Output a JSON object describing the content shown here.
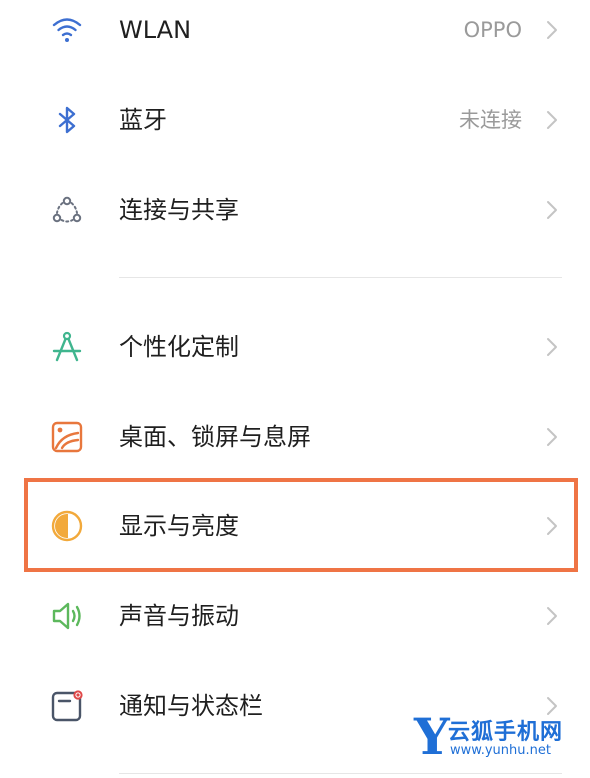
{
  "settings": {
    "items": [
      {
        "label": "WLAN",
        "value": "OPPO"
      },
      {
        "label": "蓝牙",
        "value": "未连接"
      },
      {
        "label": "连接与共享",
        "value": ""
      },
      {
        "label": "个性化定制",
        "value": ""
      },
      {
        "label": "桌面、锁屏与息屏",
        "value": ""
      },
      {
        "label": "显示与亮度",
        "value": ""
      },
      {
        "label": "声音与振动",
        "value": ""
      },
      {
        "label": "通知与状态栏",
        "value": ""
      }
    ]
  },
  "colors": {
    "wifi": "#3d6fd1",
    "bluetooth": "#3d6fd1",
    "connection": "#6b7280",
    "personalize": "#3fb58e",
    "desktop": "#e8773d",
    "display": "#f2a93b",
    "sound": "#5cb85c",
    "notification": "#4a5568",
    "highlight": "#ef7445",
    "watermark": "#1f6fd6"
  },
  "watermark": {
    "logo_letter": "Y",
    "name": "云狐手机网",
    "url": "www.yunhu.net"
  }
}
